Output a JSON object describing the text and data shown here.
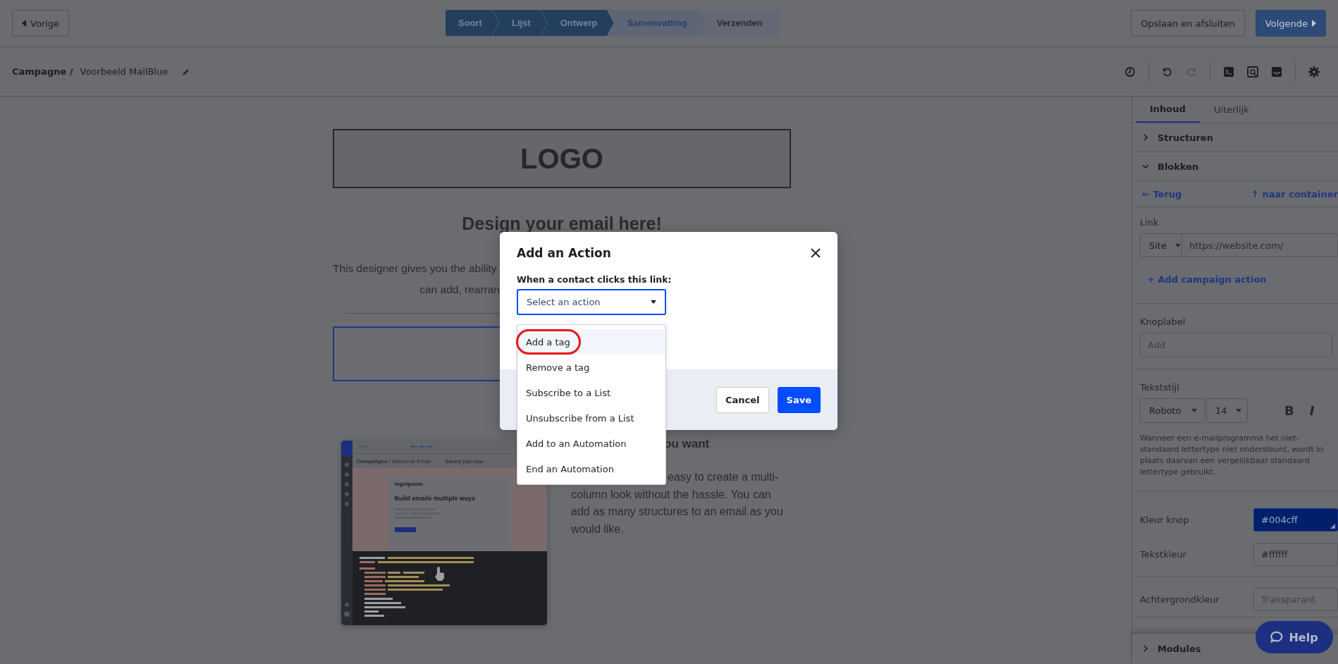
{
  "top_bar": {
    "back_button": "Vorige",
    "steps": [
      {
        "label": "Soort",
        "done": true,
        "selected": false
      },
      {
        "label": "Lijst",
        "done": true,
        "selected": false
      },
      {
        "label": "Ontwerp",
        "done": true,
        "selected": false
      },
      {
        "label": "Samenvatting",
        "done": false,
        "selected": true
      },
      {
        "label": "Verzenden",
        "done": false,
        "selected": false
      }
    ],
    "save_exit_button": "Opslaan en afsluiten",
    "next_button": "Volgende"
  },
  "toolbar": {
    "breadcrumb_root": "Campagne /",
    "campaign_name": "Voorbeeld MailBlue",
    "tools": [
      {
        "kind": "history",
        "disabled": false
      },
      {
        "kind": "undo",
        "disabled": false
      },
      {
        "kind": "redo",
        "disabled": true
      },
      {
        "kind": "code",
        "disabled": false
      },
      {
        "kind": "preview",
        "disabled": false
      },
      {
        "kind": "inbox",
        "disabled": false
      },
      {
        "kind": "settings",
        "disabled": false
      }
    ]
  },
  "canvas": {
    "logo": "LOGO",
    "heading": "Design your email here!",
    "intro_lines": [
      "This designer gives you the ability",
      "can add, rearran"
    ],
    "section_heading": "ou want",
    "body_lines": [
      "easy to create a multi-",
      "column look without the hassle. You can",
      "add as many structures to an email as you",
      "would like."
    ],
    "preview": {
      "breadcrumb_root": "Campaigns",
      "breadcrumb_page": "/ Welcome Email",
      "status": "Saved just now",
      "brand": "logoipsum",
      "headline": "Build emails multiple ways"
    }
  },
  "side_panel": {
    "tabs": [
      {
        "label": "Inhoud",
        "selected": true
      },
      {
        "label": "Uiterlijk",
        "selected": false
      }
    ],
    "sections": [
      {
        "title": "Structuren",
        "expanded": false
      },
      {
        "title": "Blokken",
        "expanded": true
      }
    ],
    "back_link": "← Terug",
    "up_link": "↑ naar container",
    "link_label": "Link",
    "link_type": "Site",
    "link_url": "https://website.com/",
    "add_action_link": "+ Add campaign action",
    "button_label_label": "Knoplabel",
    "button_label_placeholder": "Add",
    "text_style_label": "Tekststijl",
    "font": "Roboto",
    "font_size": "14",
    "bold_button": "B",
    "italic_button": "I",
    "font_note": "Wanneer een e-mailprogramma het niet-standaard lettertype niet ondersteunt, wordt in plaats daarvan een vergelijkbaar standaard lettertype gebruikt.",
    "color_rows": [
      {
        "label": "Kleur knop",
        "kind": "swatch",
        "value": "#004cff"
      },
      {
        "label": "Tekstkleur",
        "kind": "value",
        "value": "#ffffff"
      },
      {
        "label": "Achtergrondkleur",
        "kind": "empty",
        "placeholder": "Transparant"
      }
    ],
    "bottom_sections": [
      {
        "title": "Modules",
        "expanded": false
      }
    ]
  },
  "help_button": "Help",
  "modal": {
    "title": "Add an Action",
    "field_label": "When a contact clicks this link:",
    "select_placeholder": "Select an action",
    "options": [
      {
        "label": "Add a tag",
        "highlighted": true,
        "circled": true
      },
      {
        "label": "Remove a tag",
        "highlighted": false,
        "circled": false
      },
      {
        "label": "Subscribe to a List",
        "highlighted": false,
        "circled": false
      },
      {
        "label": "Unsubscribe from a List",
        "highlighted": false,
        "circled": false
      },
      {
        "label": "Add to an Automation",
        "highlighted": false,
        "circled": false
      },
      {
        "label": "End an Automation",
        "highlighted": false,
        "circled": false
      }
    ],
    "cancel_button": "Cancel",
    "save_button": "Save"
  }
}
